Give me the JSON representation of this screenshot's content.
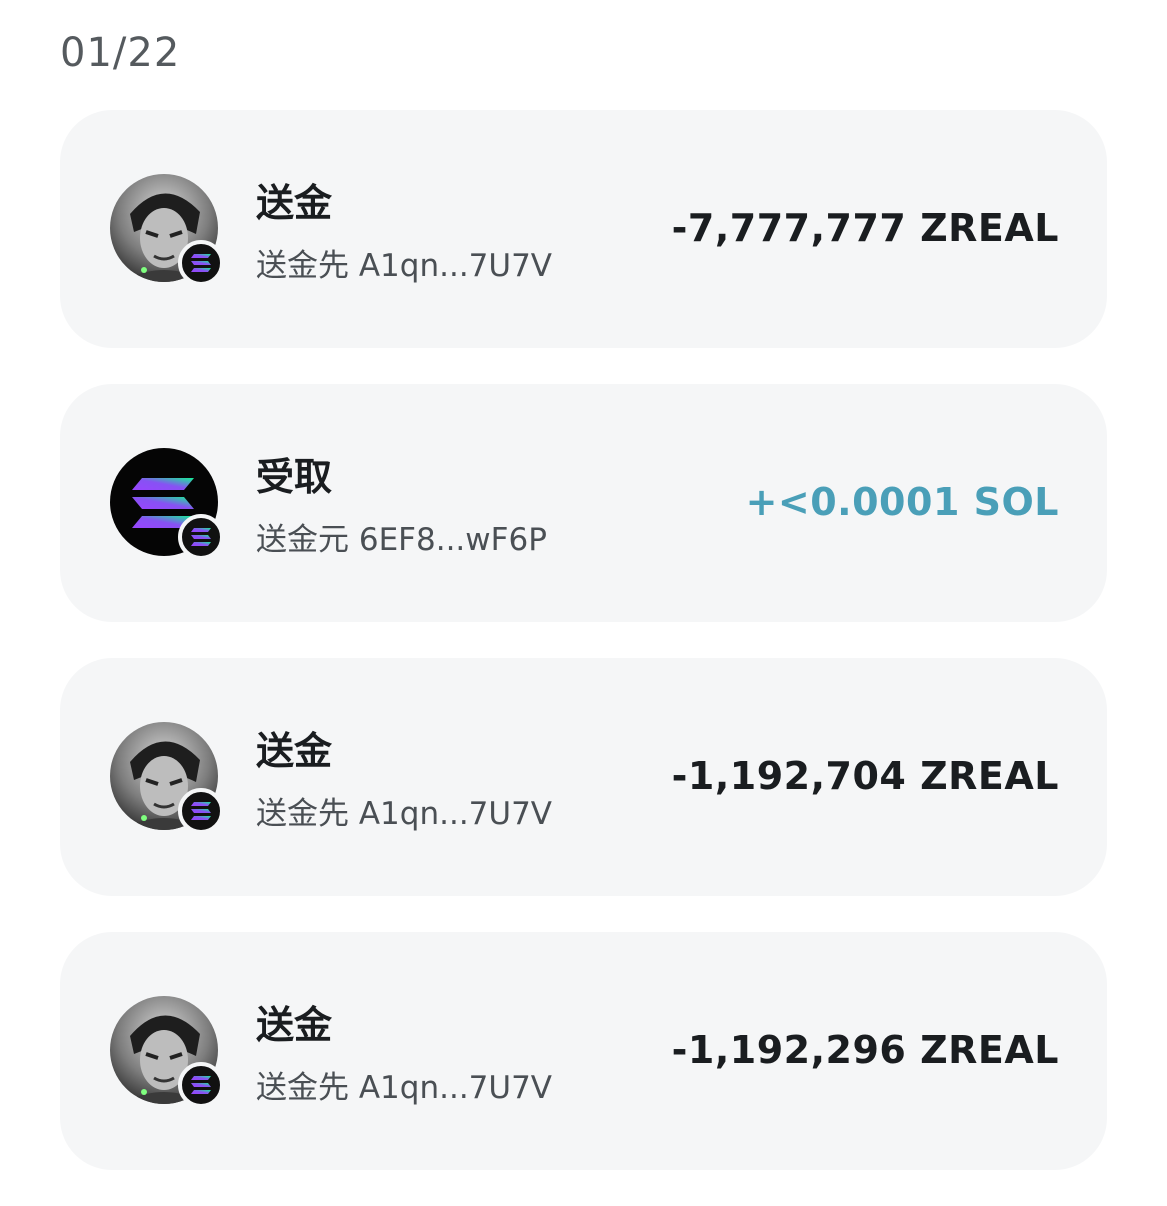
{
  "date_header": "01/22",
  "colors": {
    "incoming_amount": "#4a9fb8",
    "outgoing_amount": "#1a1d20",
    "card_background": "#f5f6f7"
  },
  "transactions": [
    {
      "type": "送金",
      "counterparty": "送金先 A1qn...7U7V",
      "amount": "-7,777,777 ZREAL",
      "direction": "outgoing",
      "avatar_icon": "profile-portrait-icon",
      "badge_icon": "solana-icon"
    },
    {
      "type": "受取",
      "counterparty": "送金元 6EF8...wF6P",
      "amount": "+<0.0001 SOL",
      "direction": "incoming",
      "avatar_icon": "solana-token-icon",
      "badge_icon": "solana-icon"
    },
    {
      "type": "送金",
      "counterparty": "送金先 A1qn...7U7V",
      "amount": "-1,192,704 ZREAL",
      "direction": "outgoing",
      "avatar_icon": "profile-portrait-icon",
      "badge_icon": "solana-icon"
    },
    {
      "type": "送金",
      "counterparty": "送金先 A1qn...7U7V",
      "amount": "-1,192,296 ZREAL",
      "direction": "outgoing",
      "avatar_icon": "profile-portrait-icon",
      "badge_icon": "solana-icon"
    }
  ]
}
